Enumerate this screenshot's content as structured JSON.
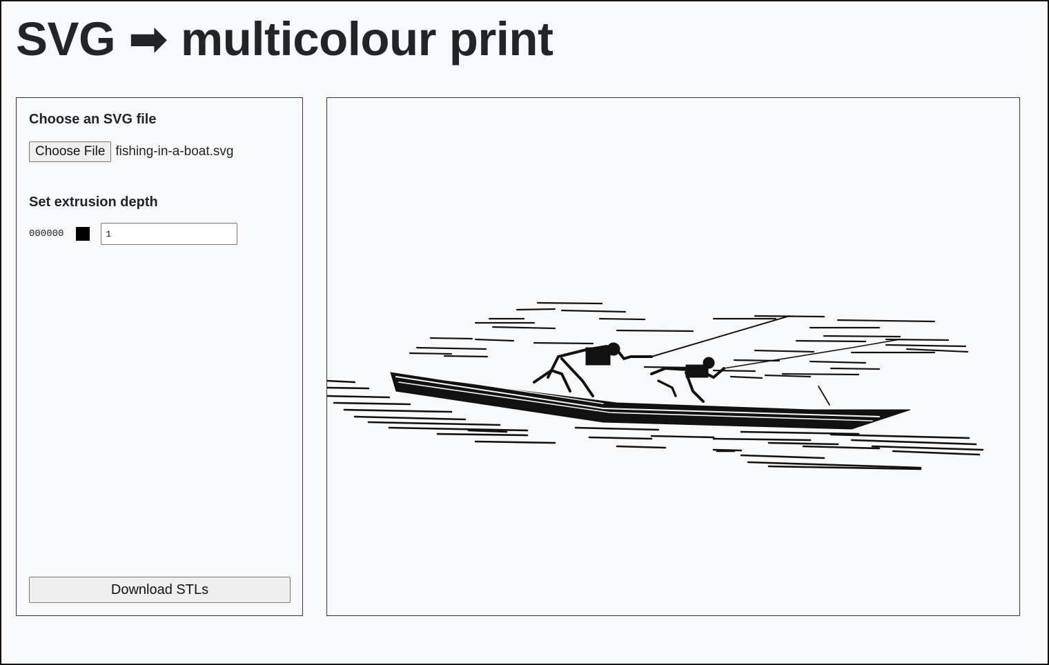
{
  "page": {
    "title": "SVG ➡ multicolour print"
  },
  "controls": {
    "file_section_label": "Choose an SVG file",
    "choose_file_button": "Choose File",
    "file_name": "fishing-in-a-boat.svg",
    "depth_section_label": "Set extrusion depth",
    "colors": [
      {
        "hex_label": "000000",
        "swatch_color": "#000000",
        "depth_value": "1"
      }
    ],
    "download_button": "Download STLs"
  },
  "preview": {
    "description_icon": "boat-illustration-icon"
  }
}
